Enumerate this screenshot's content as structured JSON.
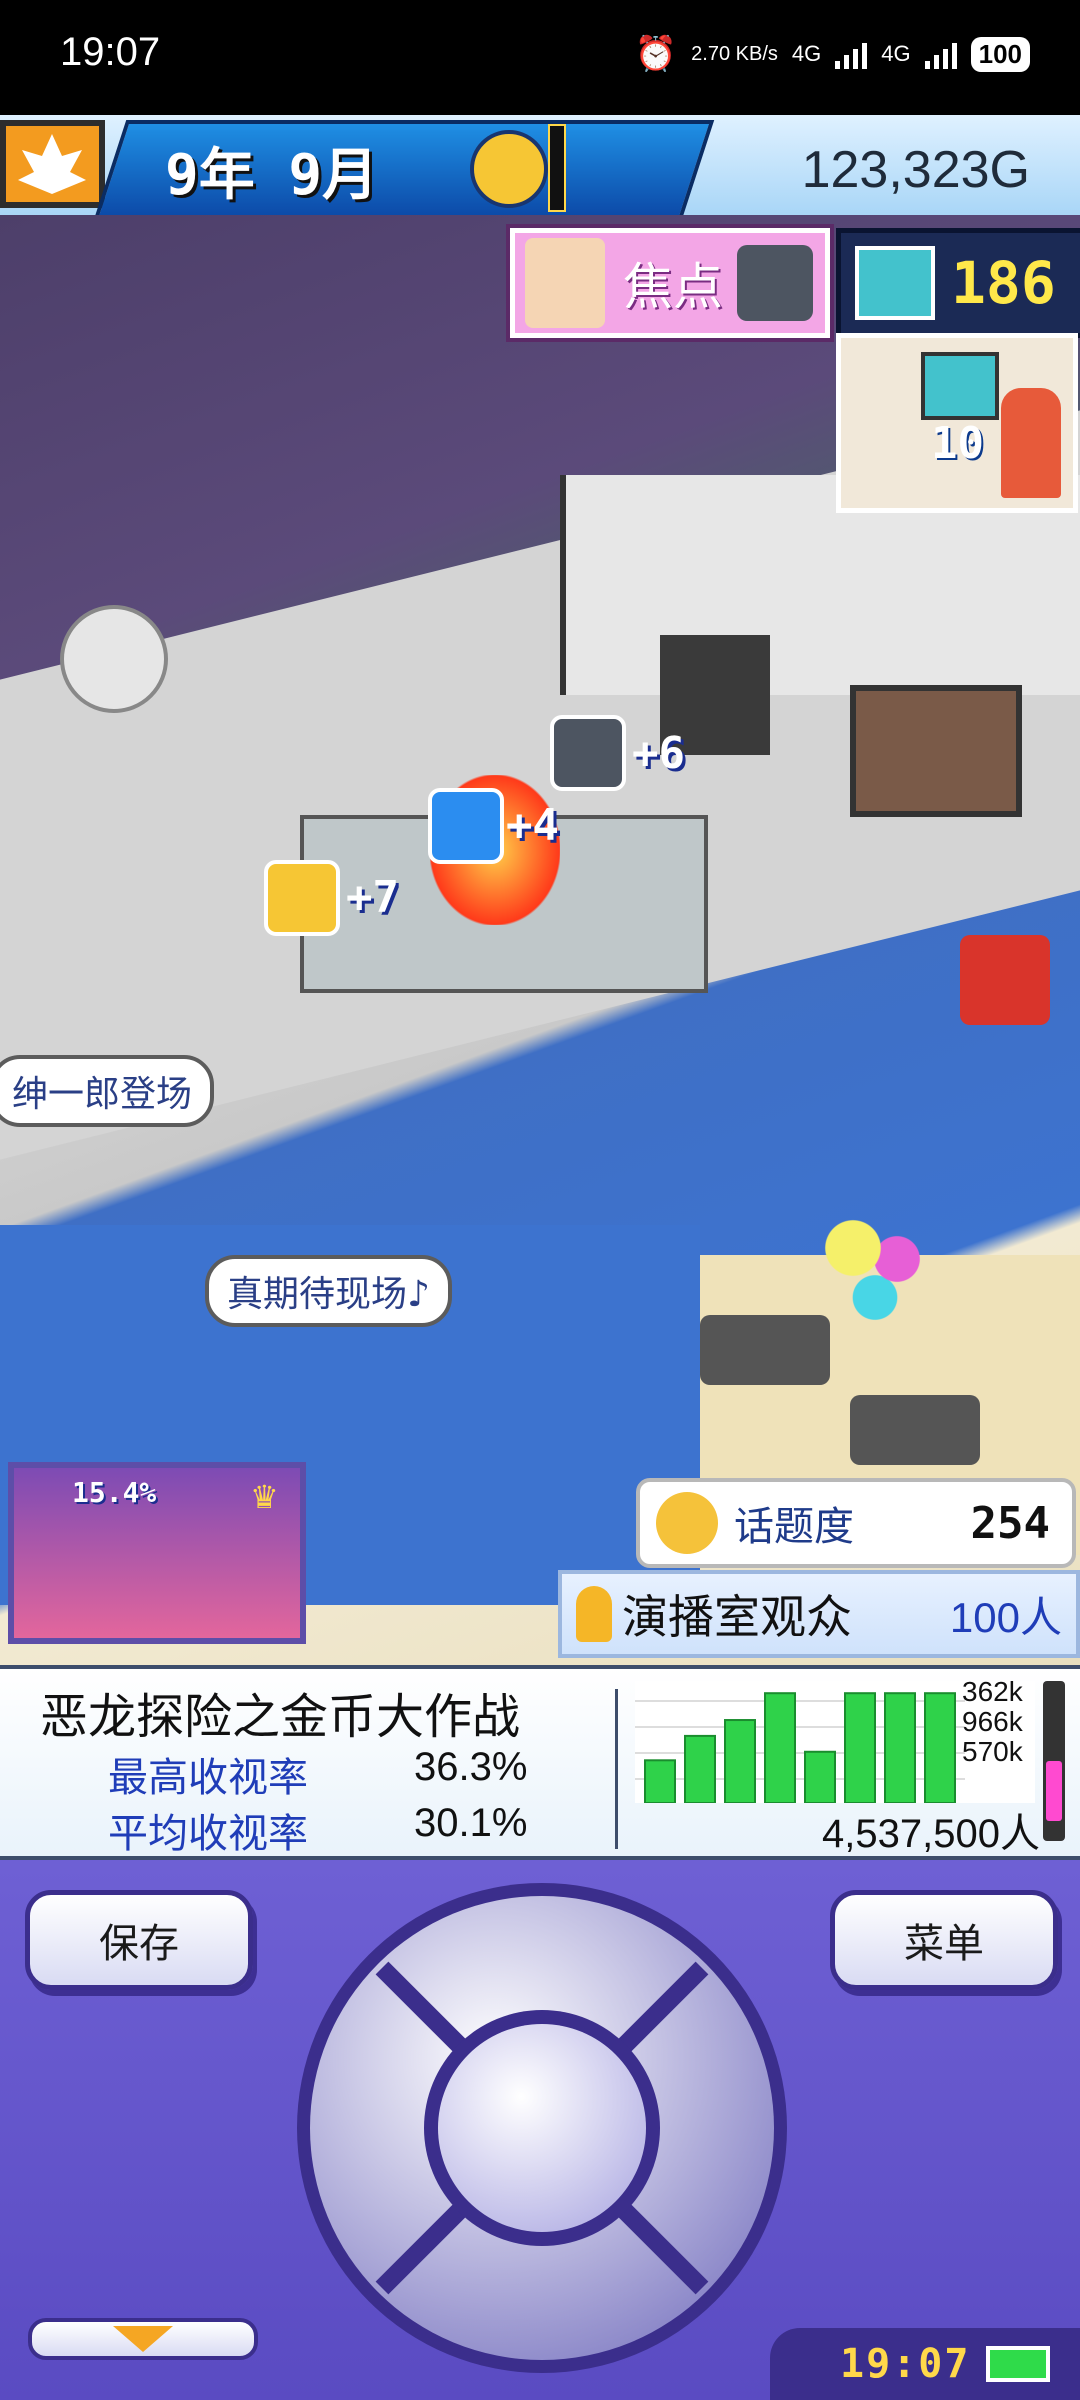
{
  "status_bar": {
    "time": "19:07",
    "net_speed": "2.70 KB/s",
    "net1": "4G",
    "net2": "4G",
    "battery": "100"
  },
  "top_bar": {
    "date": "9年 9月",
    "money": "123,323G"
  },
  "hud": {
    "focus_label": "焦点",
    "tv_count": "186",
    "studio_number": "10"
  },
  "world": {
    "bubble_1": "绅一郎登场",
    "bubble_2": "真期待现场♪",
    "plus_1": "+6",
    "plus_2": "+4",
    "plus_3": "+7",
    "thumb_rating": "15.4%"
  },
  "topic": {
    "label": "话题度",
    "value": "254"
  },
  "audience": {
    "label": "演播室观众",
    "value": "100人"
  },
  "program": {
    "name": "恶龙探险之金币大作战",
    "max_rating_label": "最高收视率",
    "max_rating_value": "36.3%",
    "avg_rating_label": "平均收视率",
    "avg_rating_value": "30.1%",
    "viewers": "4,537,500人",
    "chart_labels": [
      "362k",
      "966k",
      "570k"
    ],
    "bar_levels": [
      0.35,
      0.55,
      0.68,
      0.9,
      0.42,
      0.9,
      0.9,
      0.9
    ],
    "meter_level": 0.5,
    "colors": {
      "bars": "#2fd24a",
      "meter": "#ff4ad0"
    }
  },
  "controller": {
    "save_label": "保存",
    "menu_label": "菜单",
    "clock": "19:07"
  }
}
